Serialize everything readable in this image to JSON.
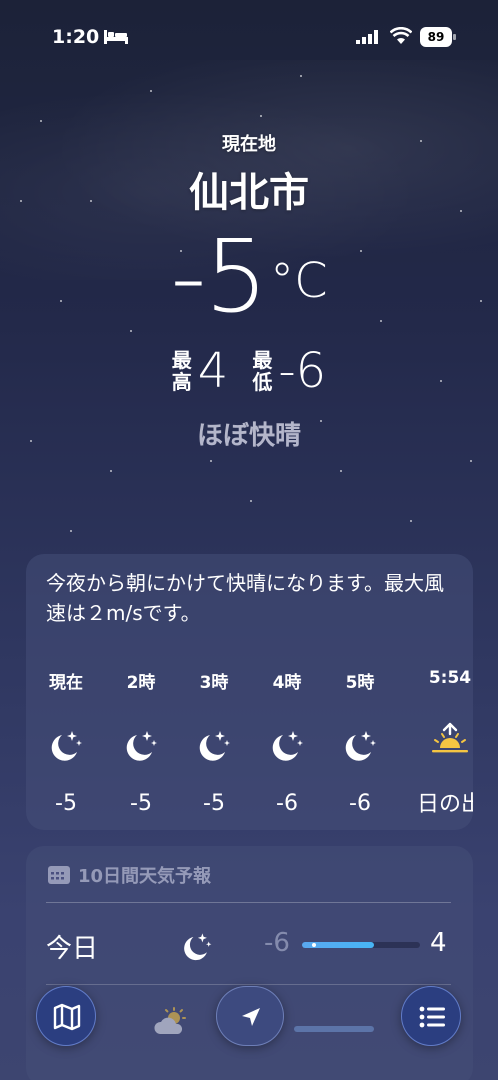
{
  "status_bar": {
    "time": "1:20",
    "battery": "89"
  },
  "weather": {
    "location_label": "現在地",
    "city": "仙北市",
    "temperature": "-5",
    "unit": "°C",
    "high_label_1": "最",
    "high_label_2": "高",
    "high": "4",
    "low_label_1": "最",
    "low_label_2": "低",
    "low": "-6",
    "condition": "ほぼ快晴"
  },
  "hourly": {
    "summary": "今夜から朝にかけて快晴になります。最大風速は２m/sです。",
    "hours": [
      {
        "label": "現在",
        "icon": "moon-stars-icon",
        "temp": "-5"
      },
      {
        "label": "2時",
        "icon": "moon-stars-icon",
        "temp": "-5"
      },
      {
        "label": "3時",
        "icon": "moon-stars-icon",
        "temp": "-5"
      },
      {
        "label": "4時",
        "icon": "moon-stars-icon",
        "temp": "-6"
      },
      {
        "label": "5時",
        "icon": "moon-stars-icon",
        "temp": "-6"
      },
      {
        "label": "5:54",
        "icon": "sunrise-icon",
        "temp": "日の出"
      }
    ]
  },
  "forecast": {
    "header": "10日間天気予報",
    "today": {
      "day": "今日",
      "icon": "moon-stars-icon",
      "low": "-6",
      "high": "4"
    },
    "next_icon": "cloud-sun-icon"
  },
  "toolbar": {
    "map": "map-icon",
    "location": "location-arrow-icon",
    "list": "list-icon"
  },
  "colors": {
    "accent_bar": "#5aa8f0",
    "sunrise": "#f5c542"
  }
}
